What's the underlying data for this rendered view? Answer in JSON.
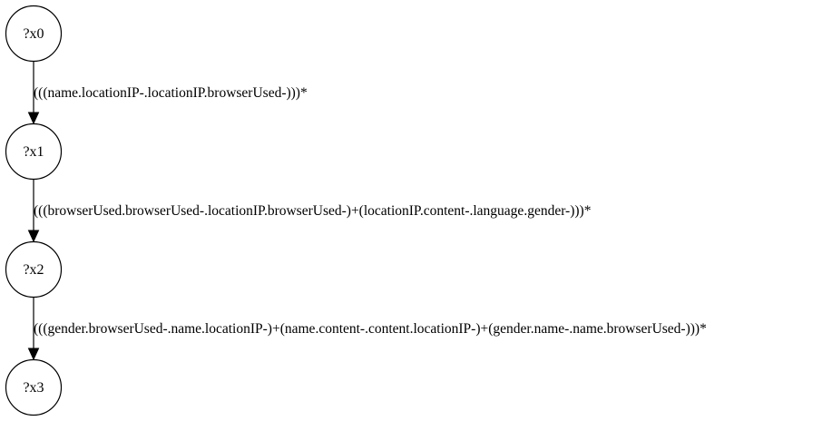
{
  "nodes": [
    {
      "id": "x0",
      "label": "?x0"
    },
    {
      "id": "x1",
      "label": "?x1"
    },
    {
      "id": "x2",
      "label": "?x2"
    },
    {
      "id": "x3",
      "label": "?x3"
    }
  ],
  "edges": [
    {
      "from": "x0",
      "to": "x1",
      "label": "(((name.locationIP-.locationIP.browserUsed-)))*"
    },
    {
      "from": "x1",
      "to": "x2",
      "label": "(((browserUsed.browserUsed-.locationIP.browserUsed-)+(locationIP.content-.language.gender-)))*"
    },
    {
      "from": "x2",
      "to": "x3",
      "label": "(((gender.browserUsed-.name.locationIP-)+(name.content-.content.locationIP-)+(gender.name-.name.browserUsed-)))*"
    }
  ]
}
